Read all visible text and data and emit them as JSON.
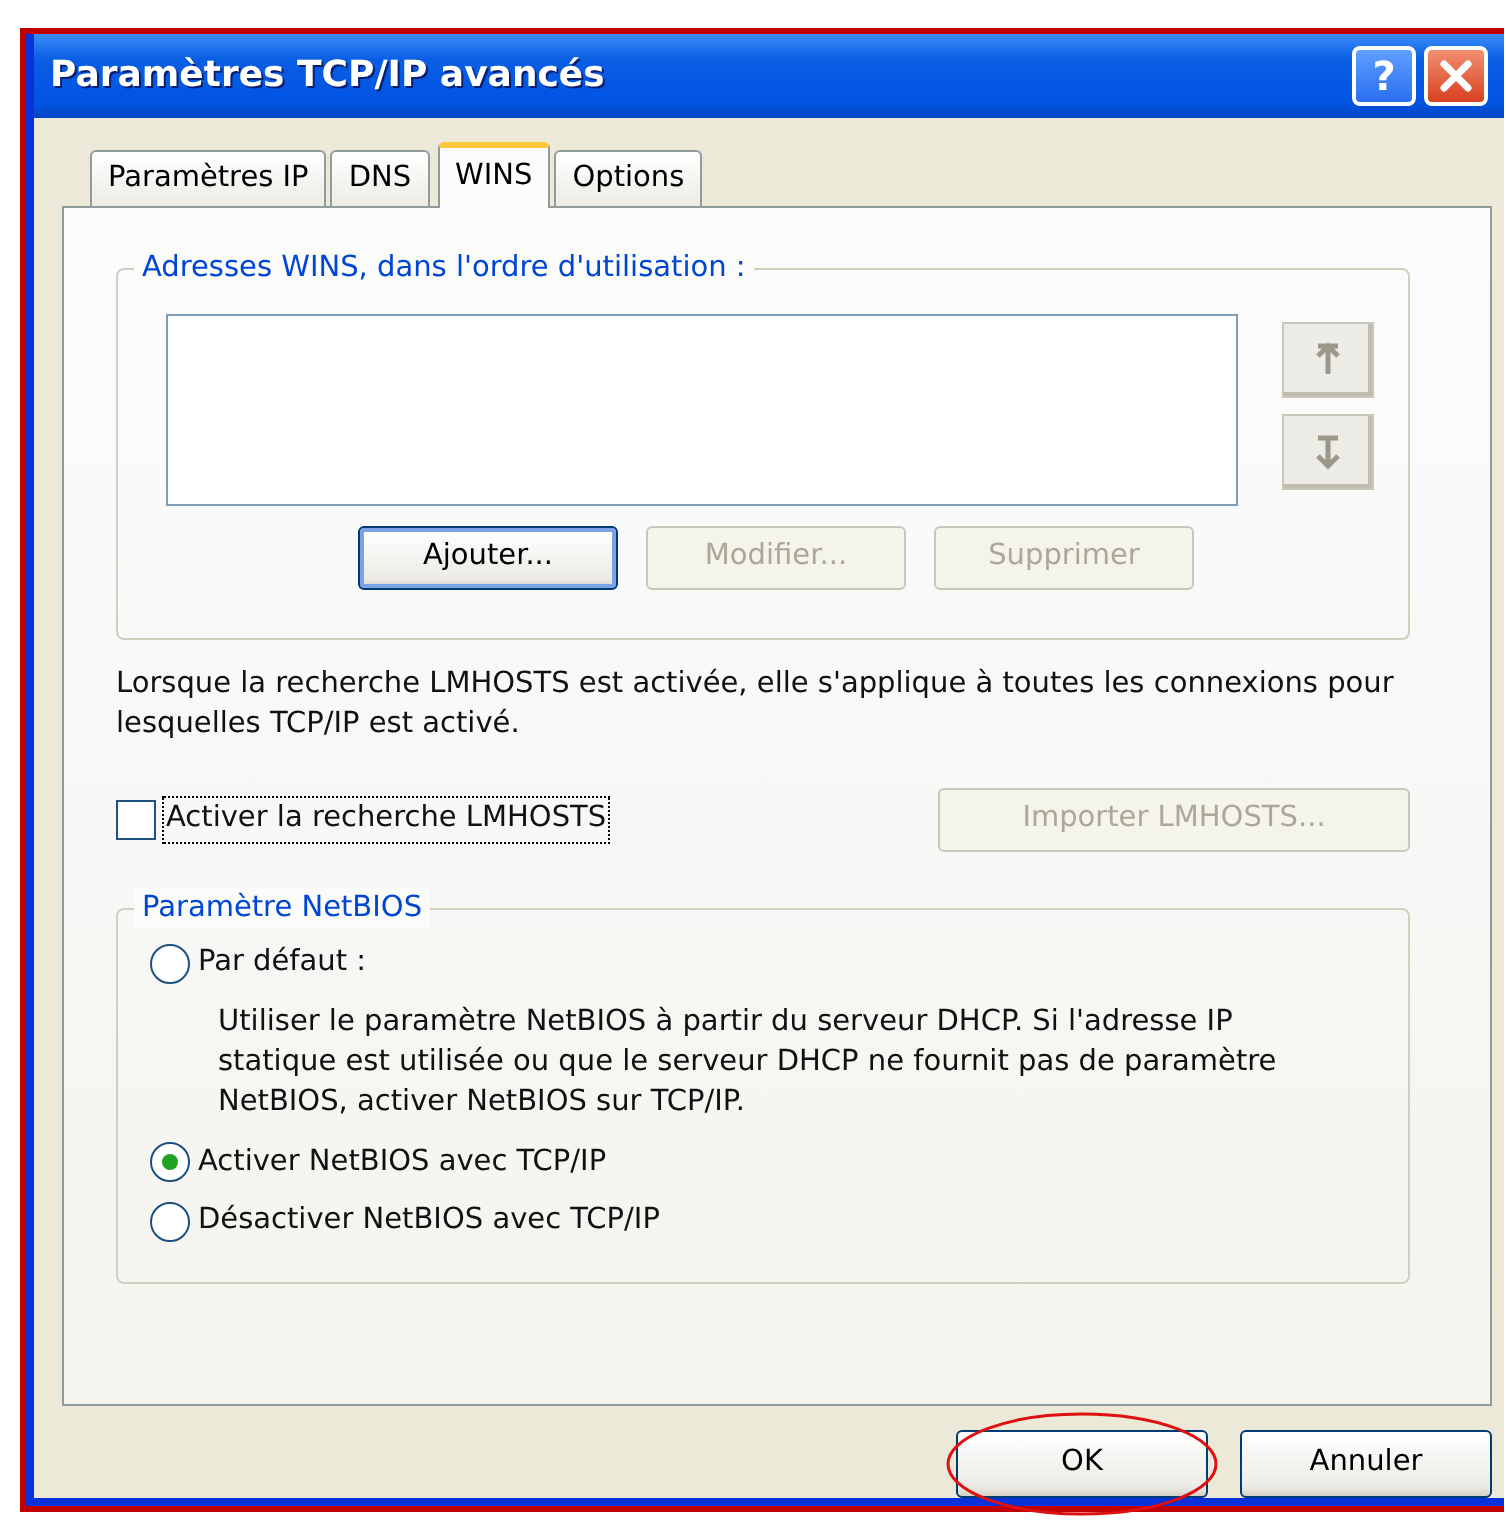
{
  "window": {
    "title": "Paramètres TCP/IP avancés",
    "help_button": "?"
  },
  "tabs": [
    {
      "label": "Paramètres IP",
      "selected": false
    },
    {
      "label": "DNS",
      "selected": false
    },
    {
      "label": "WINS",
      "selected": true
    },
    {
      "label": "Options",
      "selected": false
    }
  ],
  "wins_group": {
    "title": "Adresses WINS, dans l'ordre d'utilisation :",
    "buttons": [
      {
        "label": "Ajouter...",
        "disabled": false,
        "default": true
      },
      {
        "label": "Modifier...",
        "disabled": true,
        "default": false
      },
      {
        "label": "Supprimer",
        "disabled": true,
        "default": false
      }
    ]
  },
  "lmhosts_note": "Lorsque la recherche LMHOSTS est activée, elle s'applique à toutes les connexions pour lesquelles TCP/IP est activé.",
  "lmhosts_checkbox": {
    "label": "Activer la recherche LMHOSTS",
    "checked": false,
    "focused": true
  },
  "import_button": {
    "label": "Importer LMHOSTS...",
    "disabled": true
  },
  "netbios_group": {
    "title": "Paramètre NetBIOS",
    "options": [
      {
        "label": "Par défaut :",
        "selected": false,
        "description": "Utiliser le paramètre NetBIOS à partir du serveur DHCP. Si l'adresse IP statique est utilisée ou que le serveur DHCP ne fournit pas de paramètre NetBIOS, activer NetBIOS sur TCP/IP."
      },
      {
        "label": "Activer NetBIOS avec TCP/IP",
        "selected": true
      },
      {
        "label": "Désactiver NetBIOS avec TCP/IP",
        "selected": false
      }
    ]
  },
  "footer_buttons": [
    {
      "label": "OK",
      "circled": true
    },
    {
      "label": "Annuler",
      "circled": false
    }
  ]
}
